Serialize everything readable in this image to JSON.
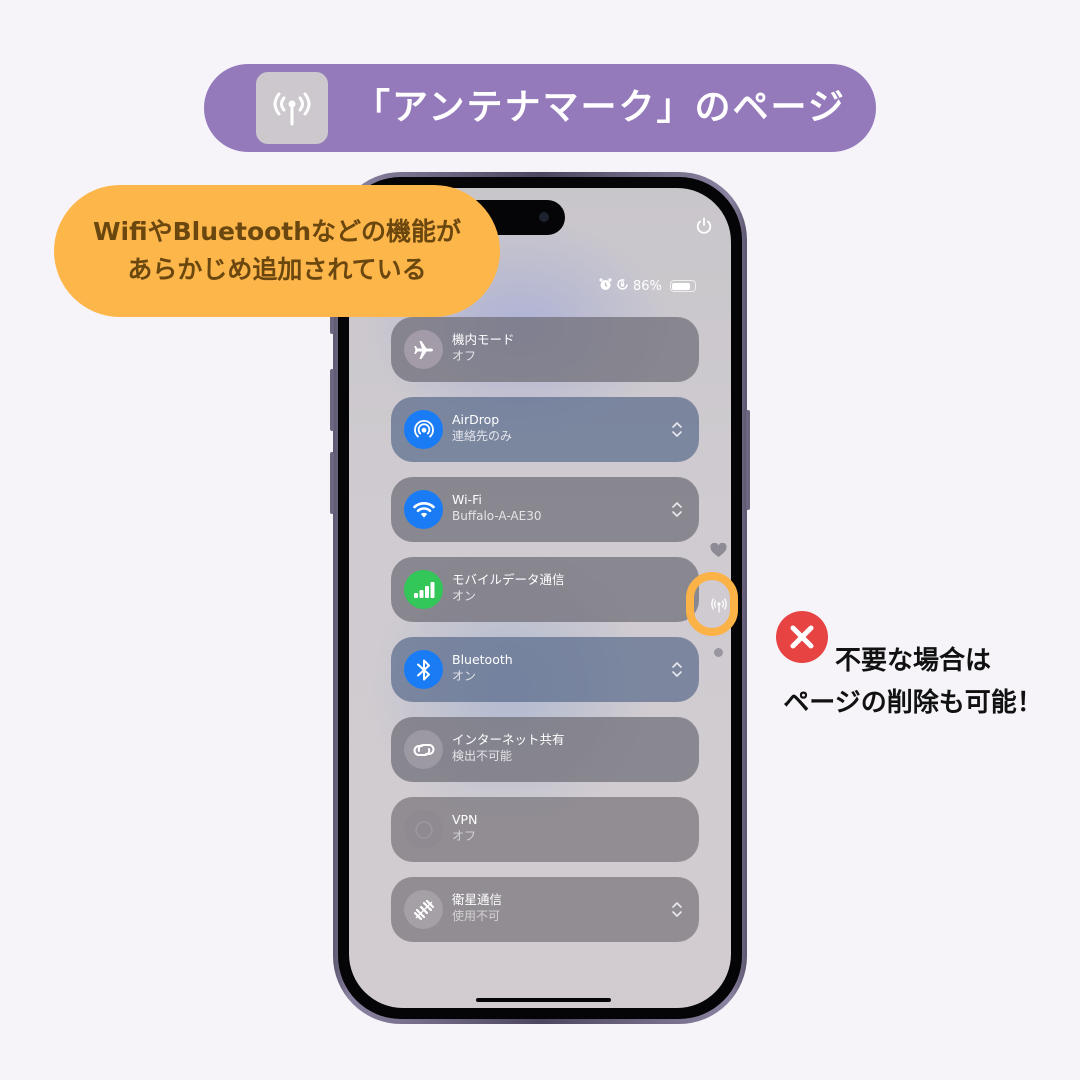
{
  "banner": {
    "icon": "antenna-icon",
    "title": "「アンテナマーク」のページ",
    "background_color": "#9479bb"
  },
  "callout": {
    "line1": "WifiやBluetoothなどの機能が",
    "line2": "あらかじめ追加されている",
    "background_color": "#fdb64a"
  },
  "note": {
    "icon": "close-icon",
    "line1": "不要な場合は",
    "line2": "ページの削除も可能！",
    "icon_color": "#e84343"
  },
  "phone": {
    "status_bar": {
      "alarm_icon": "alarm-icon",
      "rotation_lock_icon": "rotation-lock-icon",
      "battery_percent": "86%",
      "battery_level": 0.86
    },
    "power_icon": "power-icon",
    "controls": [
      {
        "title": "機内モード",
        "subtitle": "オフ",
        "icon": "airplane-icon",
        "icon_bg": "#a39ba8",
        "has_menu": false
      },
      {
        "title": "AirDrop",
        "subtitle": "連絡先のみ",
        "icon": "airdrop-icon",
        "icon_bg": "#1a7cf5",
        "has_menu": true
      },
      {
        "title": "Wi-Fi",
        "subtitle": "Buffalo-A-AE30",
        "icon": "wifi-icon",
        "icon_bg": "#1a7cf5",
        "has_menu": true
      },
      {
        "title": "モバイルデータ通信",
        "subtitle": "オン",
        "icon": "cellular-icon",
        "icon_bg": "#33c659",
        "has_menu": false
      },
      {
        "title": "Bluetooth",
        "subtitle": "オン",
        "icon": "bluetooth-icon",
        "icon_bg": "#1a7cf5",
        "has_menu": true
      },
      {
        "title": "インターネット共有",
        "subtitle": "検出不可能",
        "icon": "hotspot-icon",
        "icon_bg": "#9d99a3",
        "has_menu": false
      },
      {
        "title": "VPN",
        "subtitle": "オフ",
        "icon": "vpn-icon",
        "icon_bg": "#8f8a92",
        "has_menu": false
      },
      {
        "title": "衛星通信",
        "subtitle": "使用不可",
        "icon": "satellite-icon",
        "icon_bg": "#a59fa6",
        "has_menu": true
      }
    ],
    "page_indicators": [
      {
        "icon": "heart-icon",
        "active": false
      },
      {
        "icon": "antenna-icon",
        "active": true
      },
      {
        "icon": "dot-icon",
        "active": false
      }
    ]
  }
}
